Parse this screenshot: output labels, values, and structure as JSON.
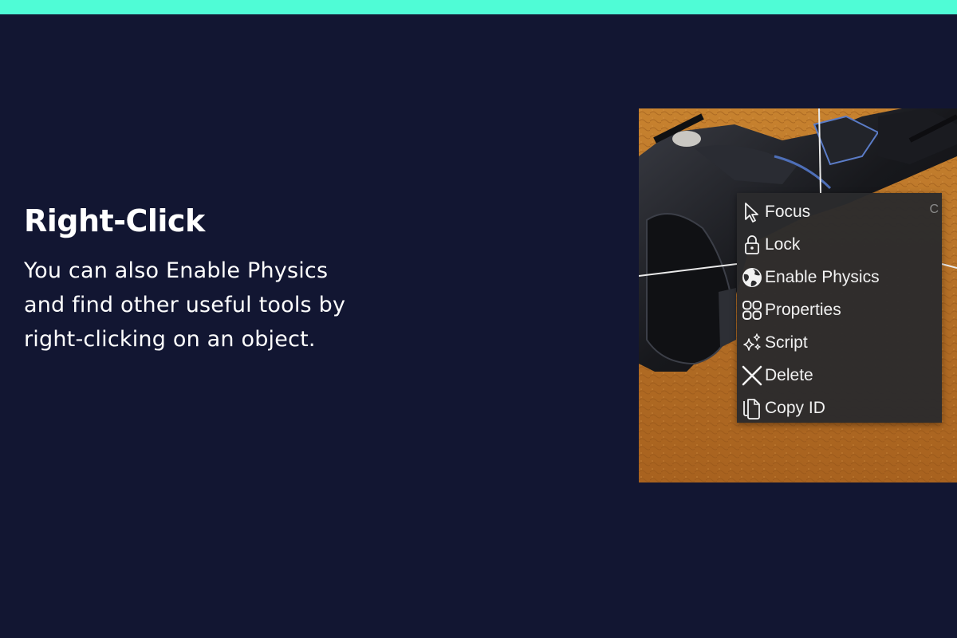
{
  "colors": {
    "background": "#121632",
    "accent_bar": "#4ffcd6",
    "text": "#ffffff",
    "menu_background": "#2b2b2d",
    "menu_text": "#f2f2f2",
    "menu_shortcut": "#8a8a8a",
    "sand": "#b8732a"
  },
  "heading": "Right-Click",
  "body": {
    "lines": [
      "You can also Enable Physics",
      "and find other useful tools by",
      "right-clicking on an object."
    ]
  },
  "context_menu": {
    "items": [
      {
        "label": "Focus",
        "icon": "cursor-icon",
        "shortcut": "C"
      },
      {
        "label": "Lock",
        "icon": "lock-icon"
      },
      {
        "label": "Enable Physics",
        "icon": "globe-icon"
      },
      {
        "label": "Properties",
        "icon": "grid-icon"
      },
      {
        "label": "Script",
        "icon": "sparkles-icon"
      },
      {
        "label": "Delete",
        "icon": "close-icon"
      },
      {
        "label": "Copy ID",
        "icon": "copy-icon"
      }
    ]
  }
}
